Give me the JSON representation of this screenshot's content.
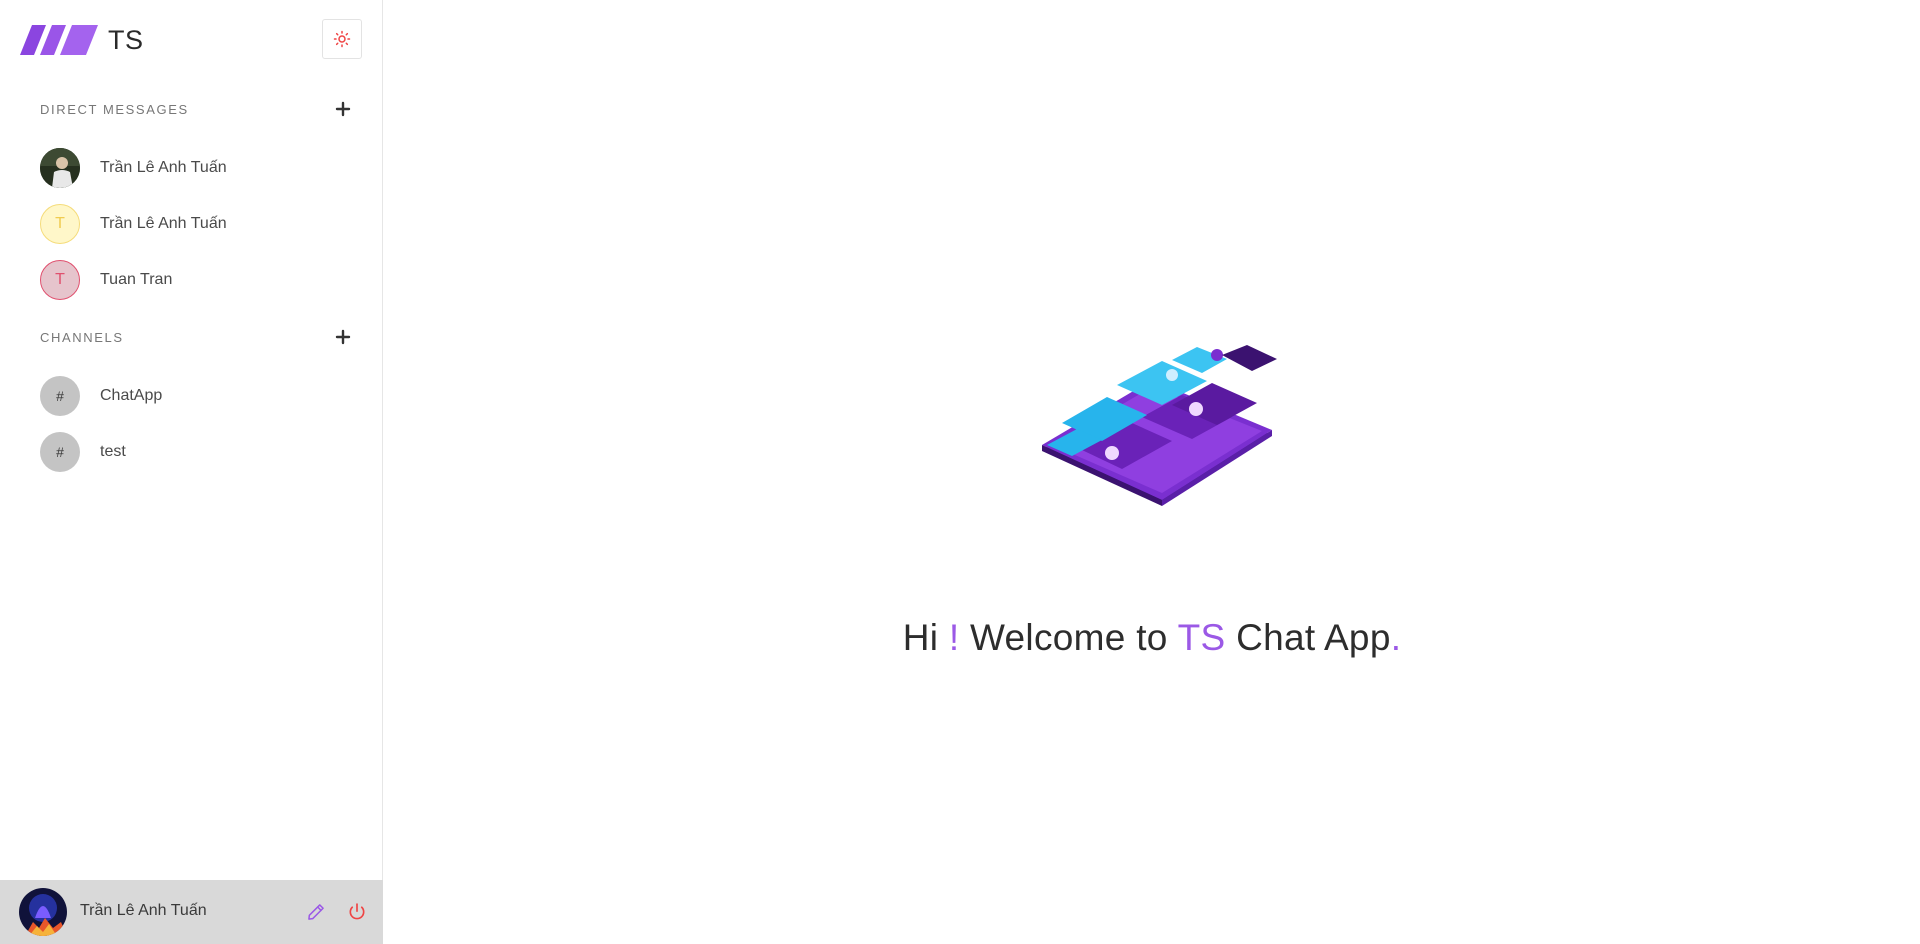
{
  "app": {
    "logo_text": "TS"
  },
  "sidebar": {
    "direct_messages": {
      "title": "DIRECT MESSAGES",
      "items": [
        {
          "label": "Trần Lê Anh Tuấn",
          "avatar_type": "photo"
        },
        {
          "label": "Trần Lê Anh Tuấn",
          "avatar_letter": "T"
        },
        {
          "label": "Tuan Tran",
          "avatar_letter": "T"
        }
      ]
    },
    "channels": {
      "title": "CHANNELS",
      "items": [
        {
          "label": "ChatApp",
          "avatar_letter": "#"
        },
        {
          "label": "test",
          "avatar_letter": "#"
        }
      ]
    }
  },
  "footer": {
    "user_name": "Trần Lê Anh Tuấn"
  },
  "main": {
    "welcome": {
      "part1": "Hi ",
      "exclaim": "!",
      "part2": " Welcome to ",
      "brand": "TS",
      "part3": " Chat App",
      "dot": "."
    }
  },
  "colors": {
    "accent": "#9b59e6",
    "danger": "#ef4444",
    "footer_bg": "#d9d9d9"
  },
  "icons": {
    "theme": "sun-icon",
    "add": "plus-icon",
    "edit": "pencil-icon",
    "logout": "power-icon"
  }
}
